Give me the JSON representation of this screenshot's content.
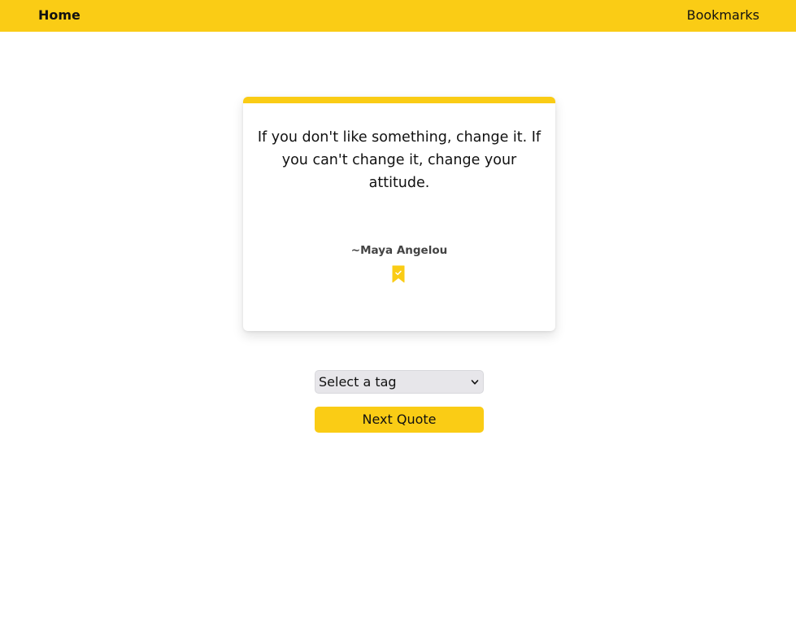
{
  "nav": {
    "home_label": "Home",
    "bookmarks_label": "Bookmarks"
  },
  "quote": {
    "text": "If you don't like something, change it. If you can't change it, change your attitude.",
    "author": "~Maya Angelou",
    "bookmark_icon": "bookmark-check-icon",
    "bookmarked": true
  },
  "controls": {
    "tag_select_value": "Select a tag",
    "next_button_label": "Next Quote"
  },
  "colors": {
    "accent": "#facc15",
    "select_bg": "#e7e6ea",
    "author_text": "#444444"
  }
}
